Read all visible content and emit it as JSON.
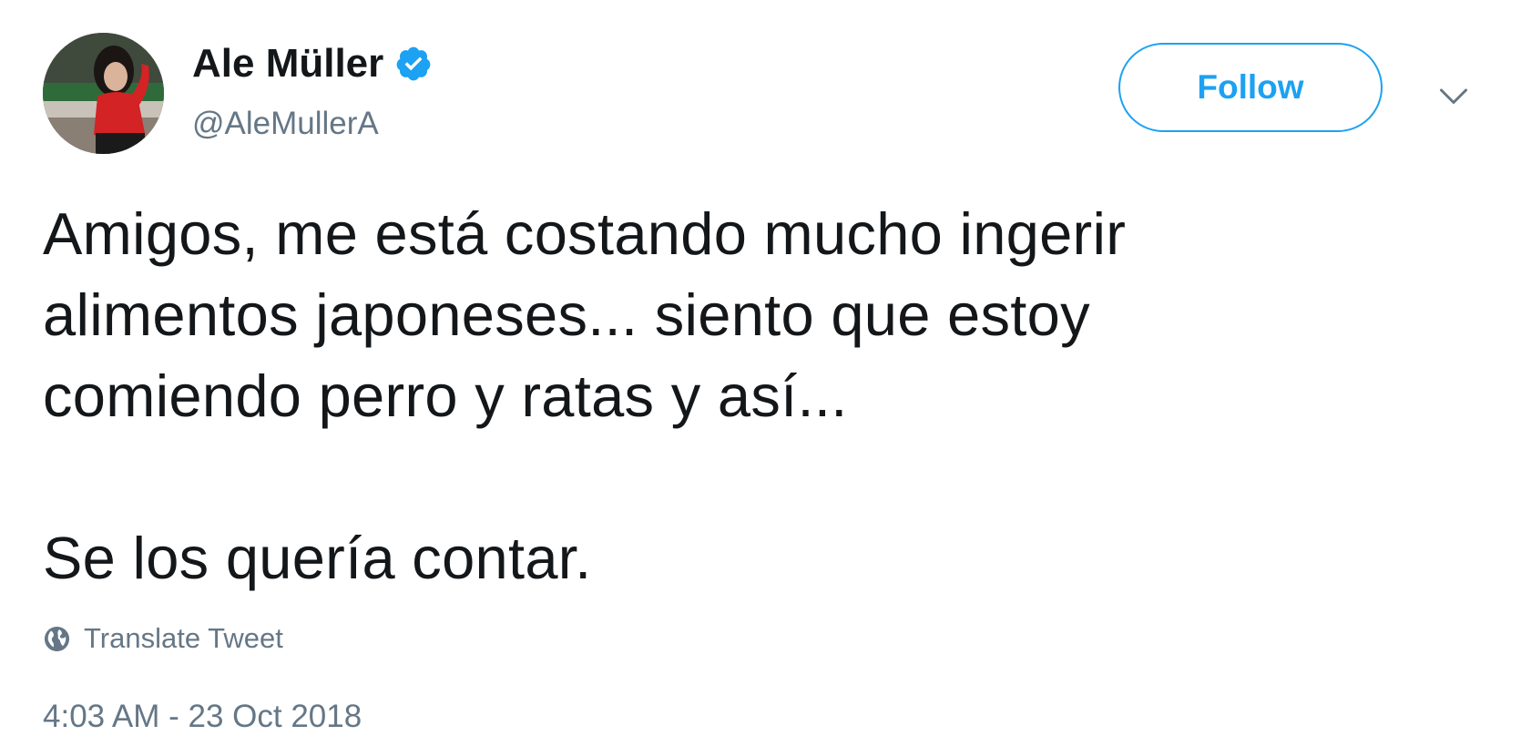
{
  "author": {
    "name": "Ale Müller",
    "handle": "@AleMullerA",
    "verified": true,
    "avatar": "profile-photo"
  },
  "actions": {
    "follow_label": "Follow",
    "menu_icon": "chevron-down-icon"
  },
  "tweet": {
    "lines": [
      "Amigos, me está costando mucho ingerir",
      "alimentos japoneses... siento que estoy",
      "comiendo perro y ratas y así...",
      "Se los quería contar."
    ],
    "translate_label": "Translate Tweet",
    "timestamp": "4:03 AM - 23 Oct 2018"
  },
  "colors": {
    "accent": "#1da1f2",
    "text": "#14171a",
    "secondary": "#657786"
  }
}
